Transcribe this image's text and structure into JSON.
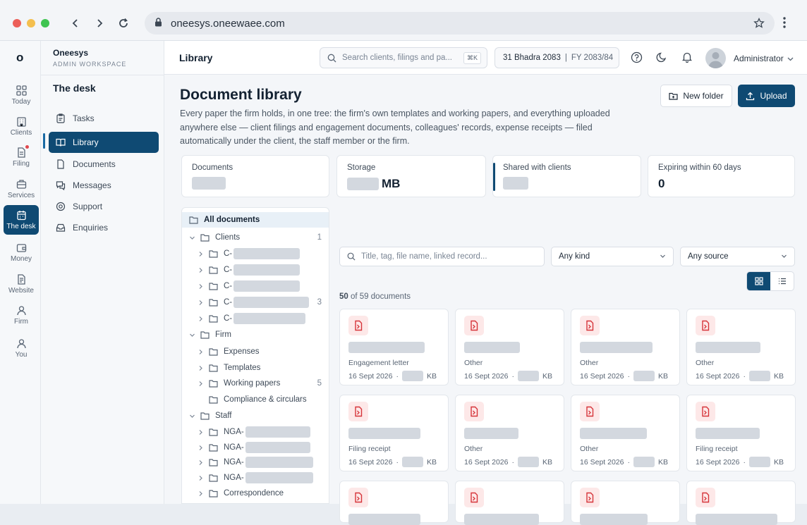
{
  "browser": {
    "url": "oneesys.oneewaee.com",
    "traffic_lights": [
      "#ec5f59",
      "#f4bf4f",
      "#3fc451"
    ]
  },
  "rail": {
    "logo": "o",
    "items": [
      {
        "label": "Today",
        "icon": "grid-icon"
      },
      {
        "label": "Clients",
        "icon": "building-icon"
      },
      {
        "label": "Filing",
        "icon": "document-icon",
        "badge": true
      },
      {
        "label": "Services",
        "icon": "briefcase-icon"
      },
      {
        "label": "The desk",
        "icon": "calendar-icon",
        "active": true
      },
      {
        "label": "Money",
        "icon": "wallet-icon"
      },
      {
        "label": "Website",
        "icon": "page-icon"
      },
      {
        "label": "Firm",
        "icon": "user-icon"
      },
      {
        "label": "You",
        "icon": "user-icon"
      }
    ]
  },
  "sidebar": {
    "brand": "Oneesys",
    "sub": "ADMIN WORKSPACE",
    "section": "The desk",
    "items": [
      {
        "label": "Tasks",
        "icon": "clipboard-icon"
      },
      {
        "label": "Library",
        "icon": "book-icon",
        "active": true
      },
      {
        "label": "Documents",
        "icon": "file-icon"
      },
      {
        "label": "Messages",
        "icon": "chat-icon"
      },
      {
        "label": "Support",
        "icon": "lifebuoy-icon"
      },
      {
        "label": "Enquiries",
        "icon": "inbox-icon"
      }
    ]
  },
  "header": {
    "title": "Library",
    "search_placeholder": "Search clients, filings and pa...",
    "search_shortcut": "⌘K",
    "date": "31 Bhadra 2083",
    "fiscal_year": "FY 2083/84",
    "user": "Administrator"
  },
  "page": {
    "title": "Document library",
    "description": "Every paper the firm holds, in one tree: the firm's own templates and working papers, and everything uploaded anywhere else — client filings and engagement documents, colleagues' records, expense receipts — filed automatically under the client, the staff member or the firm.",
    "new_folder": "New folder",
    "upload": "Upload"
  },
  "stats": [
    {
      "label": "Documents",
      "value": ""
    },
    {
      "label": "Storage",
      "value": "MB"
    },
    {
      "label": "Shared with clients",
      "value": ""
    },
    {
      "label": "Expiring within 60 days",
      "value": "0"
    }
  ],
  "tree": {
    "all": "All documents",
    "clients": {
      "label": "Clients",
      "count": "1"
    },
    "client_prefix": "C-",
    "client_counts": [
      "",
      "",
      "",
      "3",
      ""
    ],
    "firm": "Firm",
    "firm_items": [
      {
        "label": "Expenses",
        "count": ""
      },
      {
        "label": "Templates",
        "count": ""
      },
      {
        "label": "Working papers",
        "count": "5"
      },
      {
        "label": "Compliance & circulars",
        "count": ""
      }
    ],
    "staff": "Staff",
    "staff_prefix": "NGA-",
    "correspondence": "Correspondence"
  },
  "filters": {
    "search_placeholder": "Title, tag, file name, linked record...",
    "kind": "Any kind",
    "source": "Any source"
  },
  "results": {
    "shown": "50",
    "total_text": "of 59 documents"
  },
  "cards": [
    {
      "kind": "Engagement letter",
      "date": "16 Sept 2026",
      "unit": "KB"
    },
    {
      "kind": "Other",
      "date": "16 Sept 2026",
      "unit": "KB"
    },
    {
      "kind": "Other",
      "date": "16 Sept 2026",
      "unit": "KB"
    },
    {
      "kind": "Other",
      "date": "16 Sept 2026",
      "unit": "KB"
    },
    {
      "kind": "Filing receipt",
      "date": "16 Sept 2026",
      "unit": "KB"
    },
    {
      "kind": "Other",
      "date": "16 Sept 2026",
      "unit": "KB"
    },
    {
      "kind": "Other",
      "date": "16 Sept 2026",
      "unit": "KB"
    },
    {
      "kind": "Filing receipt",
      "date": "16 Sept 2026",
      "unit": "KB"
    },
    {
      "kind": "",
      "date": "",
      "unit": ""
    },
    {
      "kind": "",
      "date": "",
      "unit": ""
    },
    {
      "kind": "",
      "date": "",
      "unit": ""
    },
    {
      "kind": "",
      "date": "",
      "unit": ""
    }
  ],
  "colors": {
    "accent": "#0f4a73",
    "pdf": "#d6343a"
  }
}
